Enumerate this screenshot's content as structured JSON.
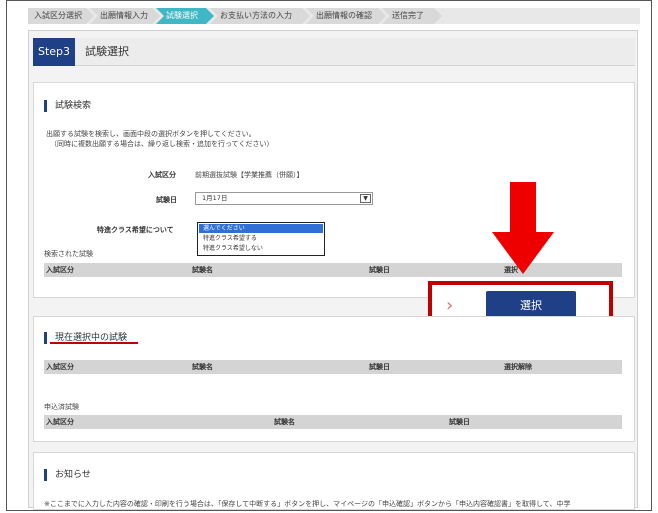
{
  "steps": [
    {
      "label": "入試区分選択",
      "active": false
    },
    {
      "label": "出願情報入力",
      "active": false
    },
    {
      "label": "試験選択",
      "active": true
    },
    {
      "label": "お支払い方法の入力",
      "active": false
    },
    {
      "label": "出願情報の確認",
      "active": false
    },
    {
      "label": "送信完了",
      "active": false
    }
  ],
  "header": {
    "badge": "Step3",
    "title": "試験選択"
  },
  "search": {
    "title": "試験検索",
    "instruction1": "出願する試験を検索し、画面中段の選択ボタンを押してください。",
    "instruction2": "（同時に複数出願する場合は、繰り返し検索・追加を行ってください）",
    "category_label": "入試区分",
    "category_value": "前期選抜試験【学業推薦（併願）】",
    "date_label": "試験日",
    "date_value": "1月17日",
    "special_label": "特進クラス希望について",
    "special_options": [
      "選んでください",
      "特進クラス希望する",
      "特進クラス希望しない"
    ],
    "special_selected": "選んでください",
    "results_label": "検索された試験",
    "columns": [
      "入試区分",
      "試験名",
      "試験日",
      "選択"
    ],
    "select_button": "選択"
  },
  "current": {
    "title": "現在選択中の試験",
    "columns": [
      "入試区分",
      "試験名",
      "試験日",
      "選択解除"
    ],
    "applied_label": "申込済試験",
    "applied_columns": [
      "入試区分",
      "試験名",
      "試験日"
    ]
  },
  "notice": {
    "title": "お知らせ",
    "text": "※ここまでに入力した内容の確認・印刷を行う場合は、「保存して中断する」ボタンを押し、マイページの「申込確認」ボタンから「申込内容確認書」を取得して、中学"
  },
  "colors": {
    "accent": "#1f3f86",
    "step_active": "#3fb7c4",
    "highlight": "#c00000"
  }
}
